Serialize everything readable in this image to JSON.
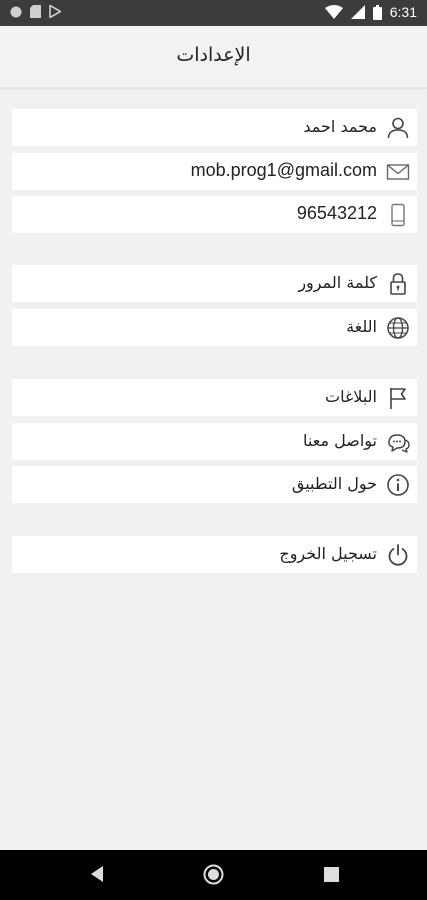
{
  "status_bar": {
    "time": "6:31"
  },
  "header": {
    "title": "الإعدادات"
  },
  "profile": {
    "name": "محمد احمد",
    "email": "mob.prog1@gmail.com",
    "phone": "96543212"
  },
  "security": {
    "password_label": "كلمة المرور",
    "language_label": "اللغة"
  },
  "support": {
    "reports_label": "البلاغات",
    "contact_label": "تواصل معنا",
    "about_label": "حول التطبيق"
  },
  "account": {
    "logout_label": "تسجيل الخروج"
  }
}
